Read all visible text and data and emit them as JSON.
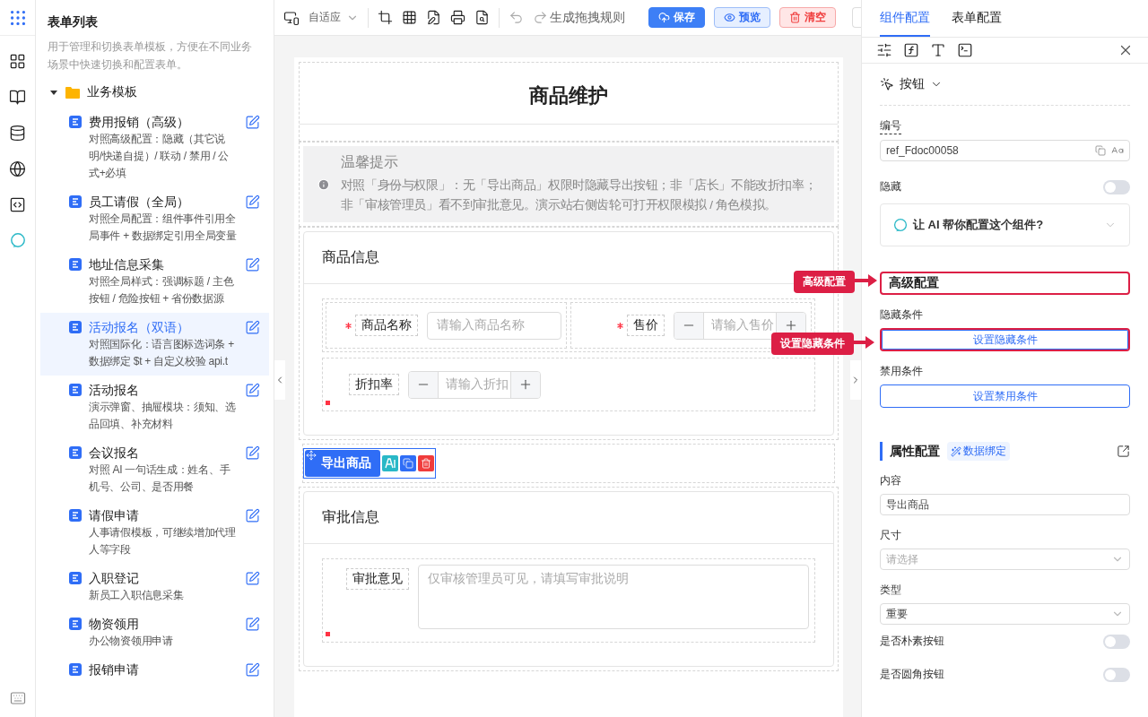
{
  "sidebar": {
    "title": "表单列表",
    "description": "用于管理和切换表单模板，方便在不同业务场景中快速切换和配置表单。",
    "folder": {
      "label": "业务模板",
      "expanded": true,
      "items": [
        {
          "title": "费用报销（高级）",
          "description": "对照高级配置：隐藏（其它说明/快递自提）/ 联动 / 禁用 / 公式+必填",
          "selected": false
        },
        {
          "title": "员工请假（全局）",
          "description": "对照全局配置：组件事件引用全局事件 + 数据绑定引用全局变量",
          "selected": false
        },
        {
          "title": "地址信息采集",
          "description": "对照全局样式：强调标题 / 主色按钮 / 危险按钮 + 省份数据源",
          "selected": false
        },
        {
          "title": "活动报名（双语）",
          "description": "对照国际化：语言图标选词条 + 数据绑定 $t + 自定义校验 api.t",
          "selected": true
        },
        {
          "title": "活动报名",
          "description": "演示弹窗、抽屉模块：须知、选品回填、补充材料",
          "selected": false
        },
        {
          "title": "会议报名",
          "description": "对照 AI 一句话生成：姓名、手机号、公司、是否用餐",
          "selected": false
        },
        {
          "title": "请假申请",
          "description": "人事请假模板，可继续增加代理人等字段",
          "selected": false
        },
        {
          "title": "入职登记",
          "description": "新员工入职信息采集",
          "selected": false
        },
        {
          "title": "物资领用",
          "description": "办公物资领用申请",
          "selected": false
        },
        {
          "title": "报销申请",
          "selected": false
        }
      ]
    }
  },
  "toolbar": {
    "viewport": "自适应",
    "rule_button": "生成拖拽规则",
    "buttons": [
      {
        "label": "保存",
        "kind": "primary"
      },
      {
        "label": "预览",
        "kind": "info"
      },
      {
        "label": "清空",
        "kind": "danger"
      }
    ]
  },
  "canvas": {
    "title": "商品维护",
    "notice": {
      "title": "温馨提示",
      "text": "对照「身份与权限」：无「导出商品」权限时隐藏导出按钮；非「店长」不能改折扣率；非「审核管理员」看不到审批意见。演示站右侧齿轮可打开权限模拟 / 角色模拟。"
    },
    "product_section": {
      "title": "商品信息",
      "rows": [
        [
          {
            "label": "商品名称",
            "required": true,
            "kind": "text",
            "placeholder": "请输入商品名称"
          },
          {
            "label": "售价",
            "required": true,
            "kind": "number",
            "placeholder": "请输入售价"
          }
        ],
        [
          {
            "label": "折扣率",
            "required": false,
            "kind": "number",
            "placeholder": "请输入折扣"
          }
        ]
      ]
    },
    "export_button": "导出商品",
    "approval_section": {
      "title": "审批信息",
      "field": {
        "label": "审批意见",
        "placeholder": "仅审核管理员可见，请填写审批说明"
      }
    }
  },
  "panel": {
    "tabs": [
      {
        "label": "组件配置",
        "selected": true
      },
      {
        "label": "表单配置",
        "selected": false
      }
    ],
    "component_type": "按钮",
    "id_field": {
      "label": "编号",
      "value": "ref_Fdoc00058"
    },
    "hidden": {
      "label": "隐藏",
      "on": false
    },
    "ai_prompt": "让 AI 帮你配置这个组件?",
    "advanced_title": "高级配置",
    "conditions": [
      {
        "label": "隐藏条件",
        "button": "设置隐藏条件",
        "highlighted": true
      },
      {
        "label": "禁用条件",
        "button": "设置禁用条件",
        "highlighted": false
      }
    ],
    "props": {
      "title": "属性配置",
      "binding": "数据绑定",
      "fields": [
        {
          "label": "内容",
          "kind": "input",
          "value": "导出商品"
        },
        {
          "label": "尺寸",
          "kind": "select",
          "placeholder": "请选择"
        },
        {
          "label": "类型",
          "kind": "select",
          "value": "重要"
        }
      ],
      "toggles": [
        {
          "label": "是否朴素按钮",
          "on": false
        },
        {
          "label": "是否圆角按钮",
          "on": false
        }
      ]
    }
  },
  "callouts": [
    {
      "label": "高级配置"
    },
    {
      "label": "设置隐藏条件"
    }
  ]
}
